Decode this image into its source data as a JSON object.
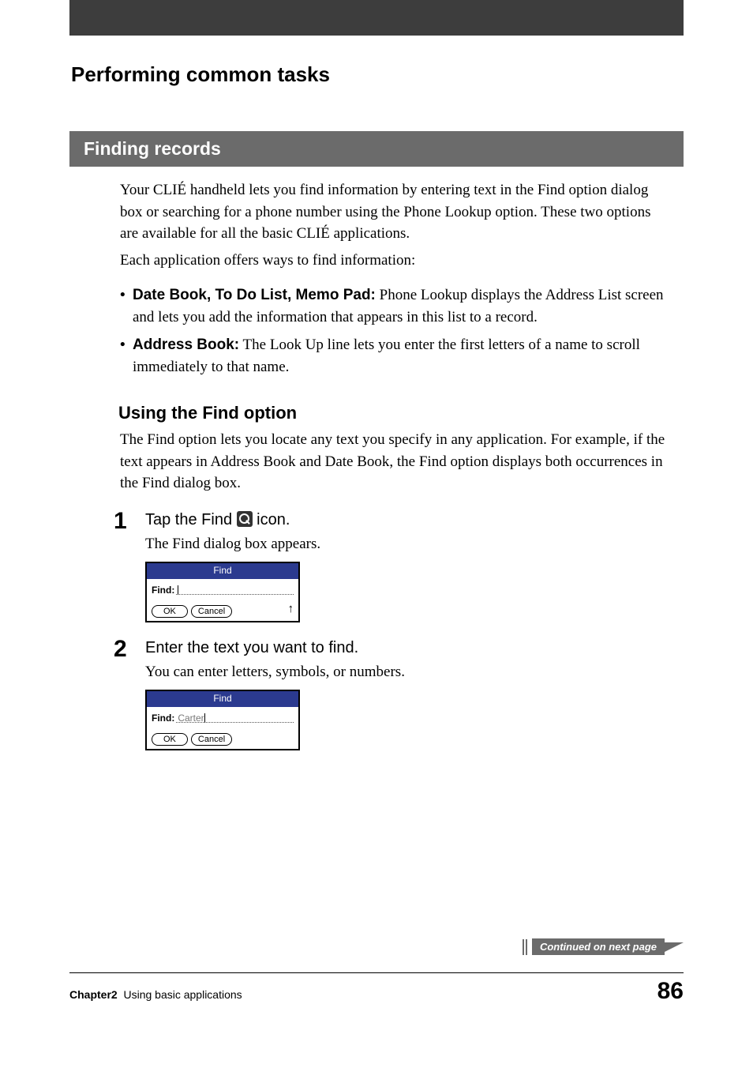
{
  "page_title": "Performing common tasks",
  "section_heading": "Finding records",
  "intro": {
    "p1": "Your CLIÉ handheld lets you find information by entering text in the Find option dialog box or searching for a phone number using the Phone Lookup option. These two options are available for all the basic CLIÉ applications.",
    "p2": "Each application offers ways to find information:"
  },
  "bullets": [
    {
      "lead": "Date Book, To Do List, Memo Pad:",
      "rest": " Phone Lookup displays the Address List screen and lets you add the information that appears in this list to a record."
    },
    {
      "lead": "Address Book:",
      "rest": " The Look Up line lets you enter the first letters of a name to scroll immediately to that name."
    }
  ],
  "subheading": "Using the Find option",
  "sub_intro": "The Find option lets you locate any text you specify in any application. For example, if the text appears in Address Book and Date Book, the Find option displays both occurrences in the Find dialog box.",
  "steps": {
    "s1": {
      "num": "1",
      "title_pre": "Tap the Find ",
      "title_post": " icon.",
      "desc": "The Find dialog box appears.",
      "dialog": {
        "title": "Find",
        "label": "Find:",
        "value": "",
        "ok": "OK",
        "cancel": "Cancel"
      }
    },
    "s2": {
      "num": "2",
      "title": "Enter the text you want to find.",
      "desc": "You can enter letters, symbols, or numbers.",
      "dialog": {
        "title": "Find",
        "label": "Find:",
        "value": "Carter",
        "ok": "OK",
        "cancel": "Cancel"
      }
    }
  },
  "continued_label": "Continued on next page",
  "footer": {
    "chapter_label": "Chapter2",
    "chapter_text": "Using basic applications",
    "page": "86"
  }
}
